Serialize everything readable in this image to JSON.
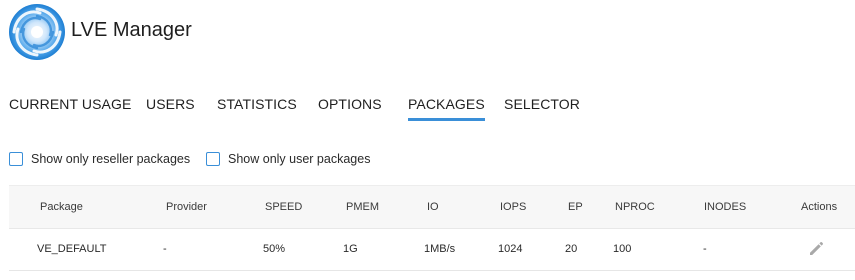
{
  "header": {
    "logo_icon": "swirl-logo-icon",
    "title": "LVE Manager",
    "brand_color": "#3a8fd8"
  },
  "tabs": [
    {
      "label": "CURRENT USAGE",
      "active": false
    },
    {
      "label": "USERS",
      "active": false
    },
    {
      "label": "STATISTICS",
      "active": false
    },
    {
      "label": "OPTIONS",
      "active": false
    },
    {
      "label": "PACKAGES",
      "active": true
    },
    {
      "label": "SELECTOR",
      "active": false
    }
  ],
  "filters": {
    "reseller": {
      "label": "Show only reseller packages",
      "checked": false
    },
    "user": {
      "label": "Show only user packages",
      "checked": false
    }
  },
  "table": {
    "columns": [
      "Package",
      "Provider",
      "SPEED",
      "PMEM",
      "IO",
      "IOPS",
      "EP",
      "NPROC",
      "INODES",
      "Actions"
    ],
    "rows": [
      {
        "cells": [
          "VE_DEFAULT",
          "-",
          "50%",
          "1G",
          "1MB/s",
          "1024",
          "20",
          "100",
          "-"
        ],
        "action_icon": "pencil-edit-icon"
      }
    ]
  }
}
